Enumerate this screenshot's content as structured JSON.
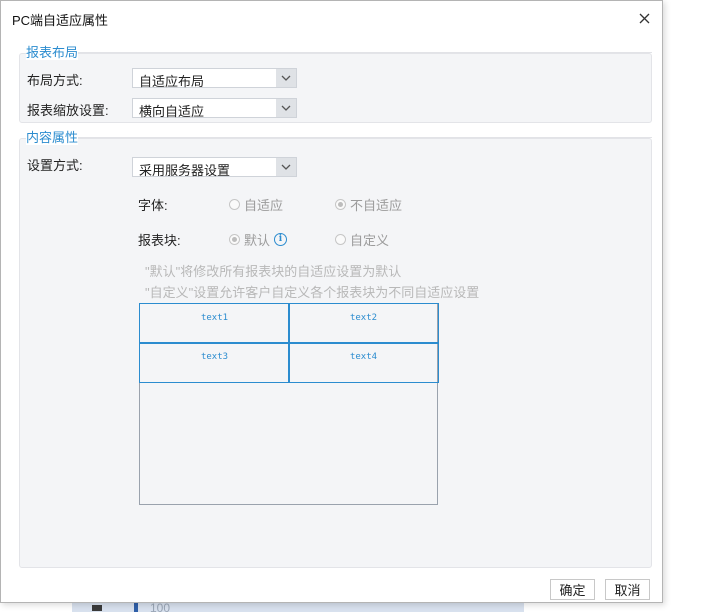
{
  "window": {
    "title": "PC端自适应属性"
  },
  "background": {
    "number": "100"
  },
  "layout_section": {
    "title": "报表布局",
    "layout_mode": {
      "label": "布局方式:",
      "value": "自适应布局"
    },
    "scale_setting": {
      "label": "报表缩放设置:",
      "value": "横向自适应"
    }
  },
  "content_section": {
    "title": "内容属性",
    "setting_mode": {
      "label": "设置方式:",
      "value": "采用服务器设置"
    },
    "font": {
      "label": "字体:",
      "options": [
        {
          "label": "自适应",
          "selected": false
        },
        {
          "label": "不自适应",
          "selected": true
        }
      ]
    },
    "block": {
      "label": "报表块:",
      "options": [
        {
          "label": "默认",
          "selected": true
        },
        {
          "label": "自定义",
          "selected": false
        }
      ]
    },
    "hints": [
      "\"默认\"将修改所有报表块的自适应设置为默认",
      "\"自定义\"设置允许客户自定义各个报表块为不同自适应设置"
    ],
    "preview_cells": [
      "text1",
      "text2",
      "text3",
      "text4"
    ]
  },
  "buttons": {
    "ok": "确定",
    "cancel": "取消"
  },
  "colors": {
    "accent": "#2b8ccf",
    "disabled_text": "#9b9b9b",
    "panel_bg": "#f4f5f7"
  },
  "icons": [
    "close-icon",
    "chevron-down-icon",
    "info-icon",
    "radio-icon"
  ]
}
